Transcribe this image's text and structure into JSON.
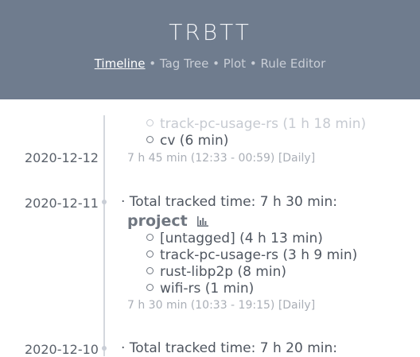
{
  "header": {
    "title": "TRBTT",
    "nav": [
      "Timeline",
      "Tag Tree",
      "Plot",
      "Rule Editor"
    ],
    "separator": "•"
  },
  "entries": [
    {
      "items": [
        "track-pc-usage-rs (1 h 18 min)",
        "cv (6 min)"
      ]
    },
    {
      "date": "2020-12-12",
      "meta": "7 h 45 min (12:33 - 00:59) [Daily]"
    },
    {
      "date": "2020-12-11",
      "total": "· Total tracked time: 7 h 30 min:",
      "project": "project",
      "items": [
        "[untagged] (4 h 13 min)",
        "track-pc-usage-rs (3 h 9 min)",
        "rust-libp2p (8 min)",
        "wifi-rs (1 min)"
      ],
      "meta": "7 h 30 min (10:33 - 19:15) [Daily]"
    },
    {
      "date": "2020-12-10",
      "total": "· Total tracked time: 7 h 20 min:"
    }
  ]
}
